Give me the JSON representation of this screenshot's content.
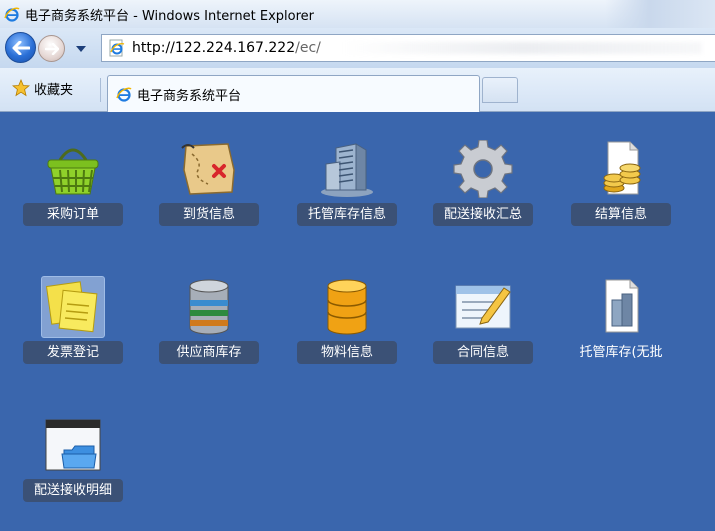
{
  "window": {
    "title": "电子商务系统平台 - Windows Internet Explorer"
  },
  "address_bar": {
    "url_host": "http://122.224.167.222",
    "url_path": "/ec/"
  },
  "favorites": {
    "label": "收藏夹"
  },
  "tab": {
    "label": "电子商务系统平台"
  },
  "tiles": [
    {
      "label": "采购订单",
      "icon": "shopping-basket-icon"
    },
    {
      "label": "到货信息",
      "icon": "treasure-map-icon"
    },
    {
      "label": "托管库存信息",
      "icon": "office-building-icon"
    },
    {
      "label": "配送接收汇总",
      "icon": "gear-icon"
    },
    {
      "label": "结算信息",
      "icon": "coins-document-icon"
    },
    {
      "label": "发票登记",
      "icon": "sticky-notes-icon"
    },
    {
      "label": "供应商库存",
      "icon": "database-icon"
    },
    {
      "label": "物料信息",
      "icon": "gold-database-icon"
    },
    {
      "label": "合同信息",
      "icon": "pencil-form-icon"
    },
    {
      "label": "托管库存(无批",
      "icon": "building-document-icon"
    },
    {
      "label": "配送接收明细",
      "icon": "folder-window-icon"
    }
  ],
  "colors": {
    "page_bg": "#3a66ad",
    "caption_bg": "#3c4b64",
    "accent_blue": "#2a6fd6"
  }
}
